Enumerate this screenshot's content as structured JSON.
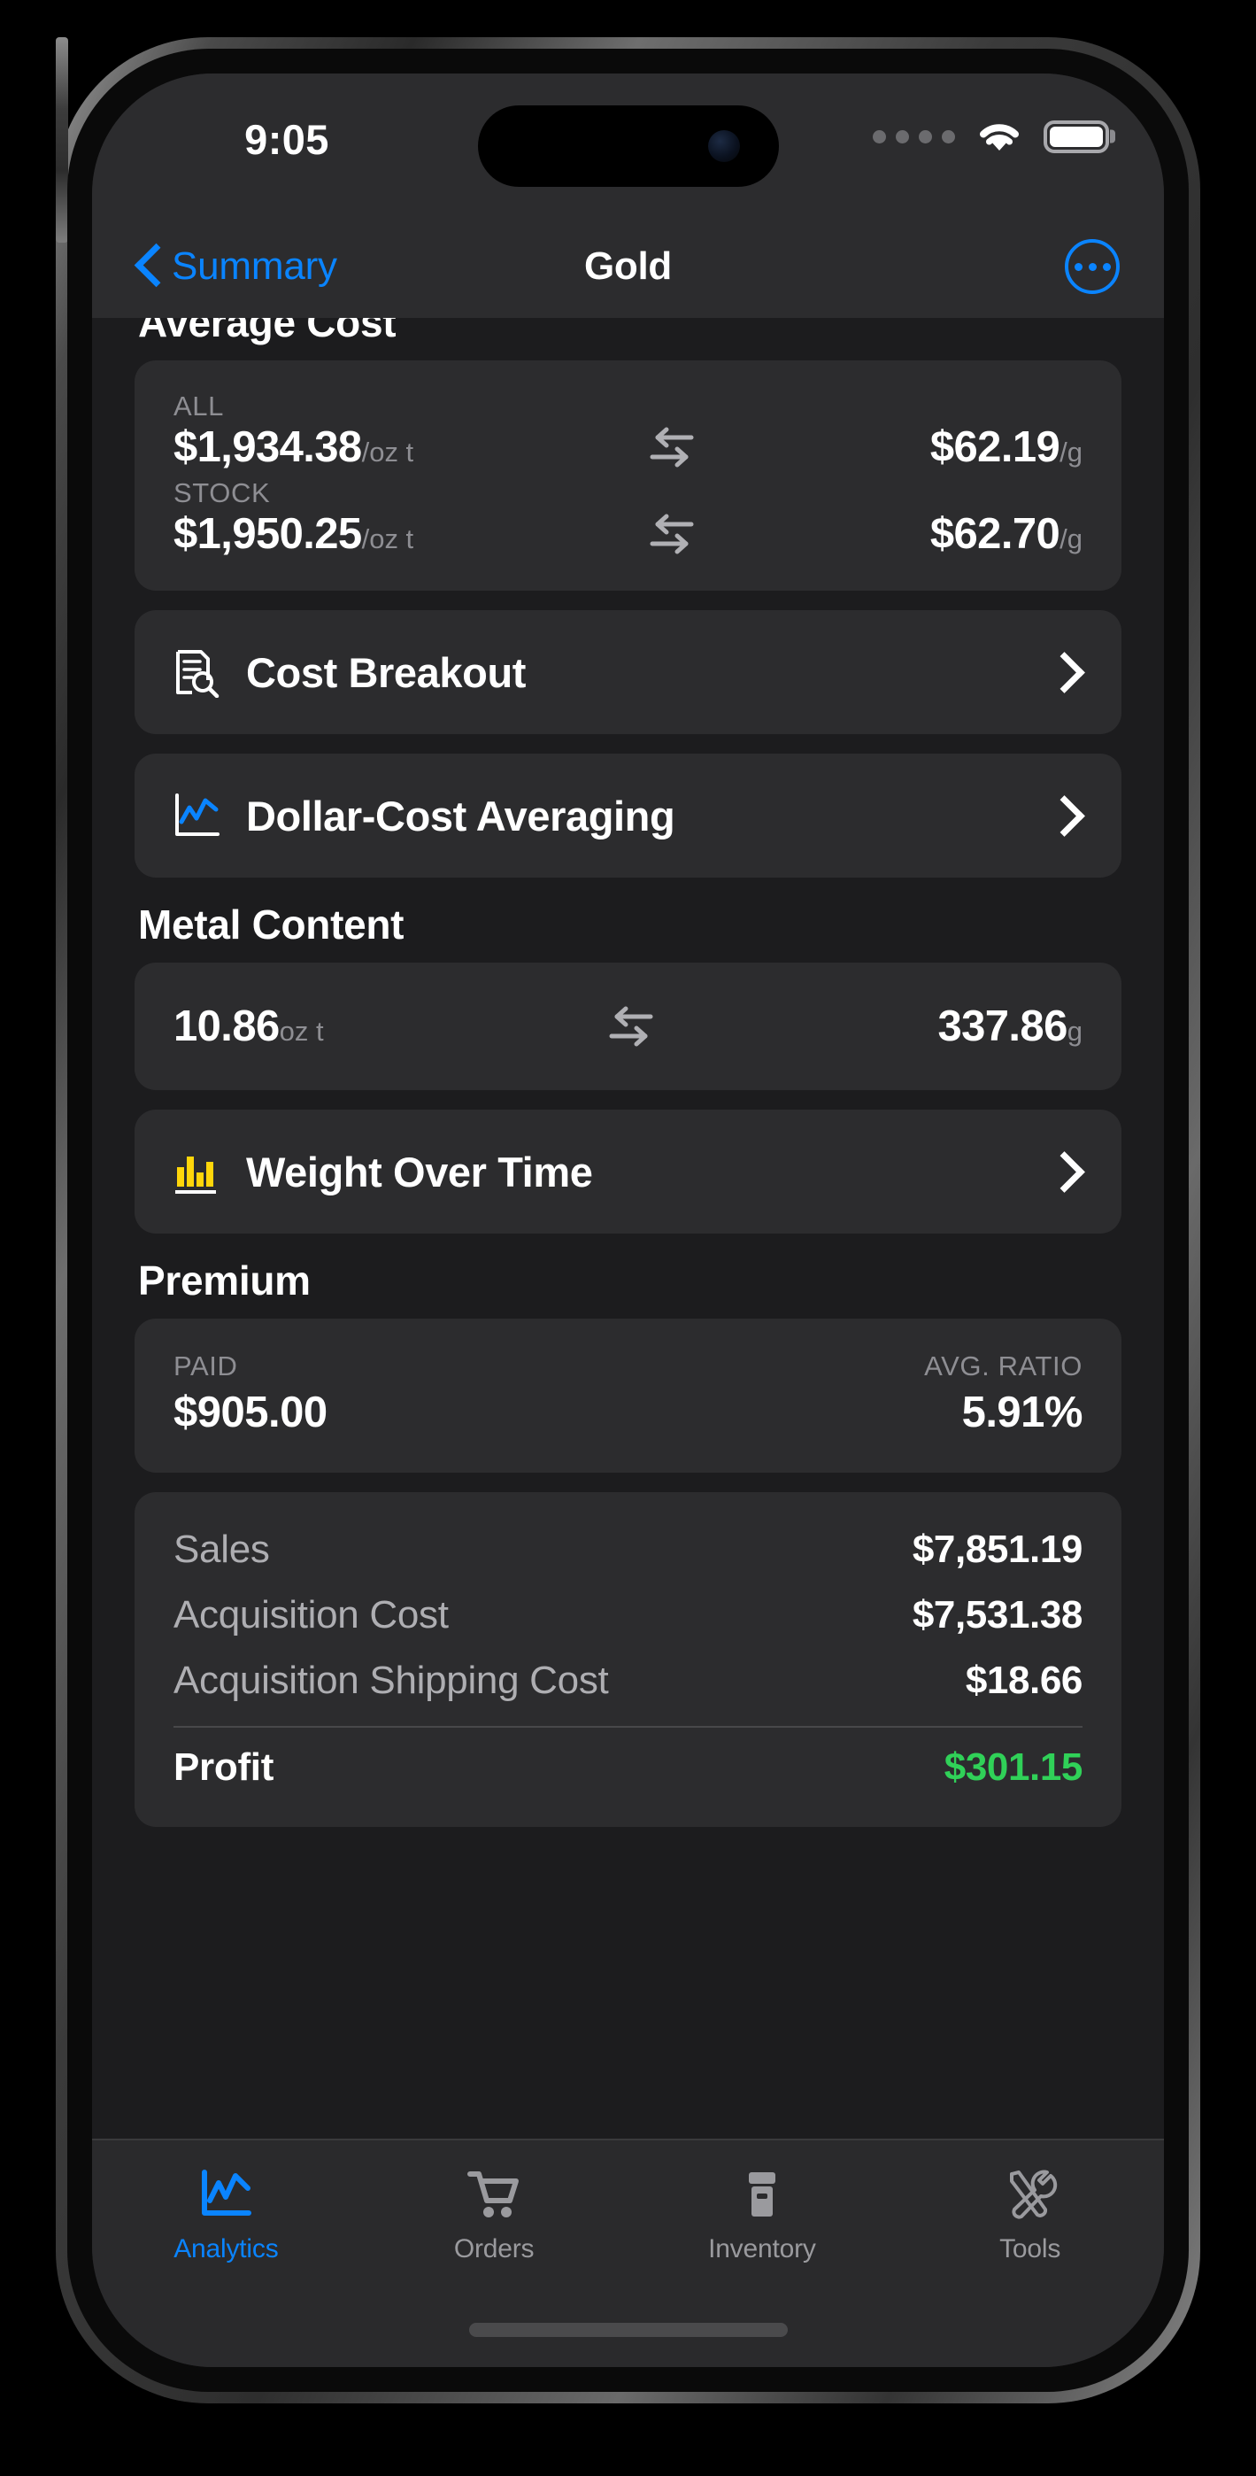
{
  "status_bar": {
    "time": "9:05",
    "signal_icon": "signal-dots-icon",
    "wifi_icon": "wifi-icon",
    "battery_icon": "battery-full-icon"
  },
  "nav": {
    "back_label": "Summary",
    "back_icon": "chevron-left-icon",
    "title": "Gold",
    "more_icon": "ellipsis-circle-icon"
  },
  "sections": {
    "average_cost": {
      "title": "Average Cost",
      "rows": [
        {
          "label": "ALL",
          "left_value": "$1,934.38",
          "left_unit": "/oz t",
          "swap_icon": "exchange-arrows-icon",
          "right_value": "$62.19",
          "right_unit": "/g"
        },
        {
          "label": "STOCK",
          "left_value": "$1,950.25",
          "left_unit": "/oz t",
          "swap_icon": "exchange-arrows-icon",
          "right_value": "$62.70",
          "right_unit": "/g"
        }
      ]
    },
    "links": [
      {
        "label": "Cost Breakout",
        "icon": "document-magnifier-icon",
        "icon_color": "#ffffff",
        "chevron": "chevron-right-icon"
      },
      {
        "label": "Dollar-Cost Averaging",
        "icon": "line-chart-icon",
        "icon_color": "#0a84ff",
        "chevron": "chevron-right-icon"
      }
    ],
    "metal_content": {
      "title": "Metal Content",
      "left_value": "10.86",
      "left_unit": "oz t",
      "swap_icon": "exchange-arrows-icon",
      "right_value": "337.86",
      "right_unit": "g"
    },
    "weight_link": {
      "label": "Weight Over Time",
      "icon": "bar-chart-icon",
      "icon_color": "#ffd60a",
      "chevron": "chevron-right-icon"
    },
    "premium": {
      "title": "Premium",
      "paid_label": "PAID",
      "paid_value": "$905.00",
      "ratio_label": "AVG. RATIO",
      "ratio_value": "5.91%"
    },
    "summary": {
      "rows": [
        {
          "key": "Sales",
          "value": "$7,851.19"
        },
        {
          "key": "Acquisition Cost",
          "value": "$7,531.38"
        },
        {
          "key": "Acquisition Shipping Cost",
          "value": "$18.66"
        }
      ],
      "total": {
        "key": "Profit",
        "value": "$301.15",
        "color": "#30d158"
      }
    }
  },
  "tabbar": {
    "tabs": [
      {
        "label": "Analytics",
        "icon": "line-chart-icon",
        "active": true
      },
      {
        "label": "Orders",
        "icon": "shopping-cart-icon",
        "active": false
      },
      {
        "label": "Inventory",
        "icon": "archive-box-icon",
        "active": false
      },
      {
        "label": "Tools",
        "icon": "wrench-screwdriver-icon",
        "active": false
      }
    ]
  }
}
